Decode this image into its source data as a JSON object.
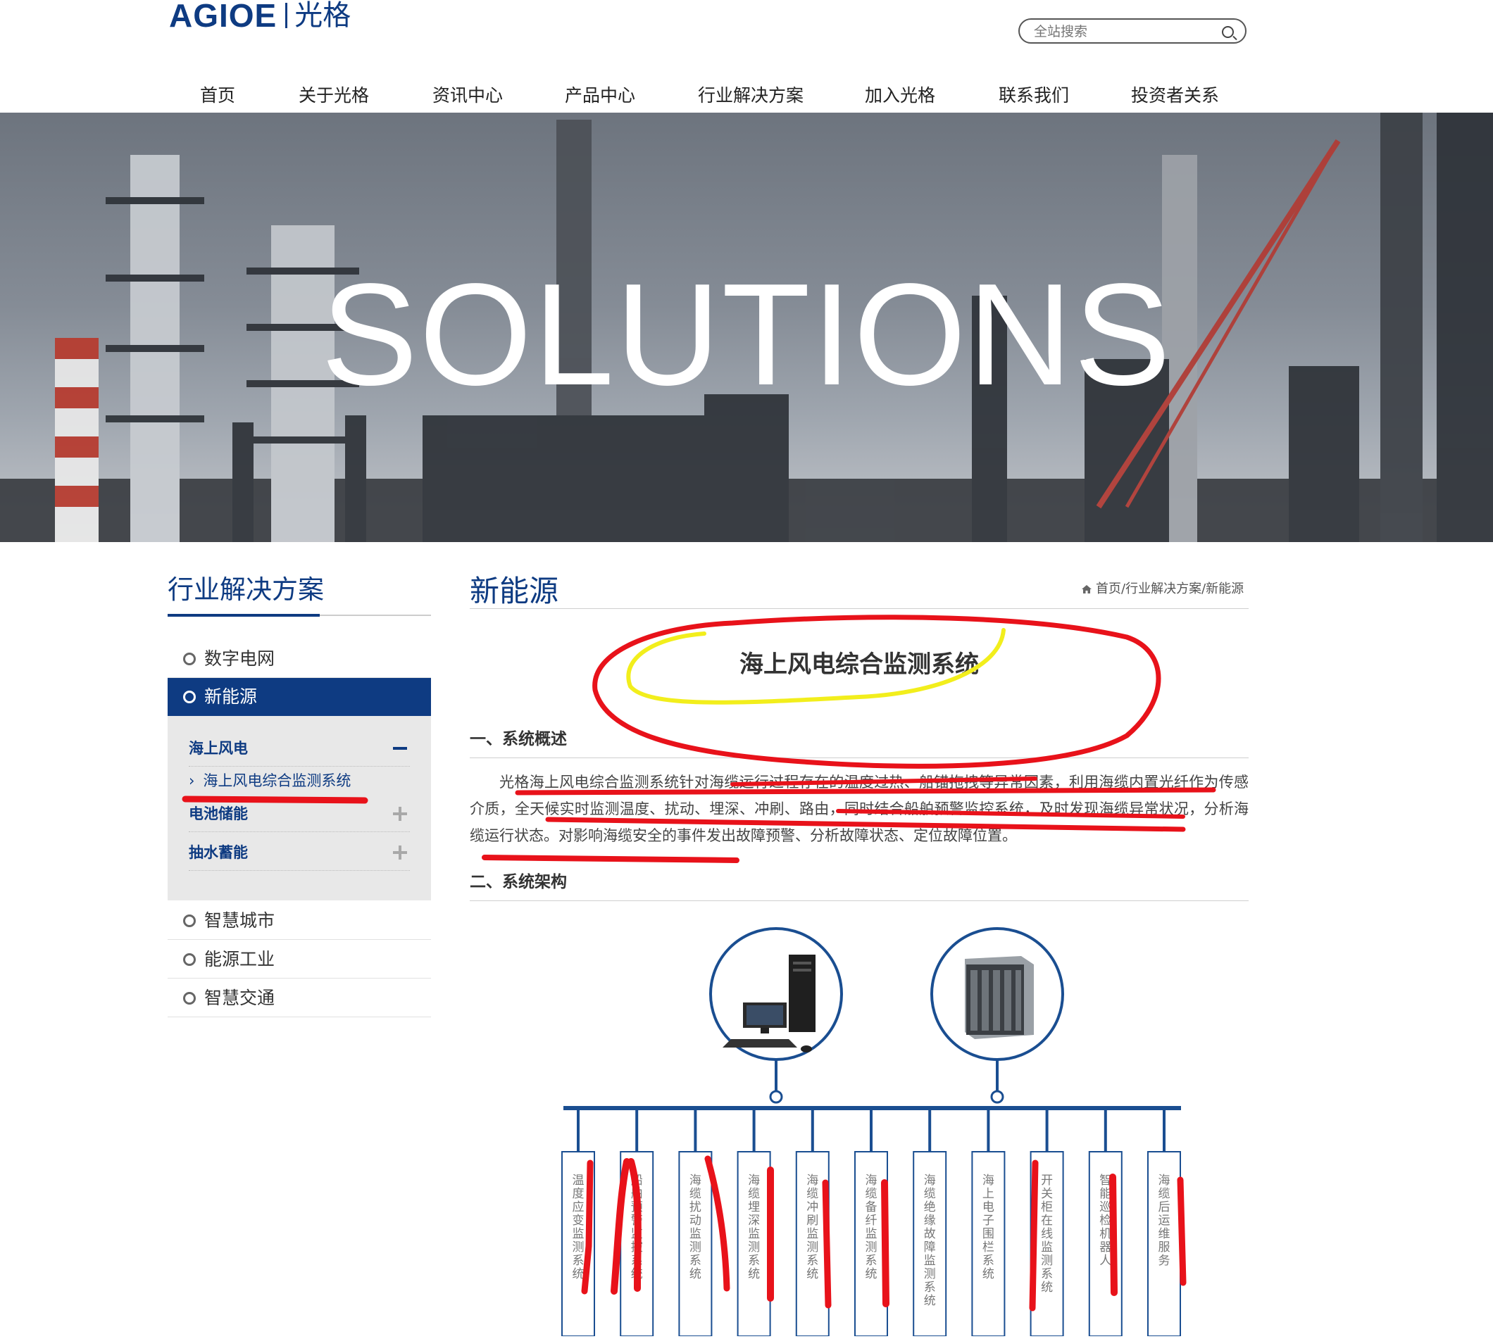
{
  "header": {
    "logo_latin": "AGIOE",
    "logo_cn": "光格",
    "search_placeholder": "全站搜索"
  },
  "nav": {
    "items": [
      "首页",
      "关于光格",
      "资讯中心",
      "产品中心",
      "行业解决方案",
      "加入光格",
      "联系我们",
      "投资者关系"
    ]
  },
  "banner": {
    "title": "SOLUTIONS"
  },
  "sidebar": {
    "title": "行业解决方案",
    "items": [
      "数字电网",
      "新能源",
      "智慧城市",
      "能源工业",
      "智慧交通"
    ],
    "active": "新能源",
    "sub_items": [
      "海上风电",
      "电池储能",
      "抽水蓄能"
    ],
    "sub_link": "海上风电综合监测系统"
  },
  "content": {
    "title": "新能源",
    "breadcrumb": "首页/行业解决方案/新能源",
    "article_title": "海上风电综合监测系统",
    "section1": "一、系统概述",
    "paragraph": "光格海上风电综合监测系统针对海缆运行过程存在的温度过热、船锚拖拽等异常因素，利用海缆内置光纤作为传感介质，全天候实时监测温度、扰动、埋深、冲刷、路由，同时结合船舶预警监控系统，及时发现海缆异常状况，分析海缆运行状态。对影响海缆安全的事件发出故障预警、分析故障状态、定位故障位置。",
    "section2": "二、系统架构"
  },
  "diagram": {
    "subsystems": [
      "温度应变监测系统",
      "船舶预警监控系统",
      "海缆扰动监测系统",
      "海缆埋深监测系统",
      "海缆冲刷监测系统",
      "海缆备纤监测系统",
      "海缆绝缘故障监测系统",
      "海上电子围栏系统",
      "开关柜在线监测系统",
      "智能巡检机器人",
      "海缆后运维服务"
    ]
  },
  "colors": {
    "brand_blue": "#0e3b82",
    "annotation_red": "#e8121a",
    "annotation_yellow": "#f2ee1c"
  }
}
